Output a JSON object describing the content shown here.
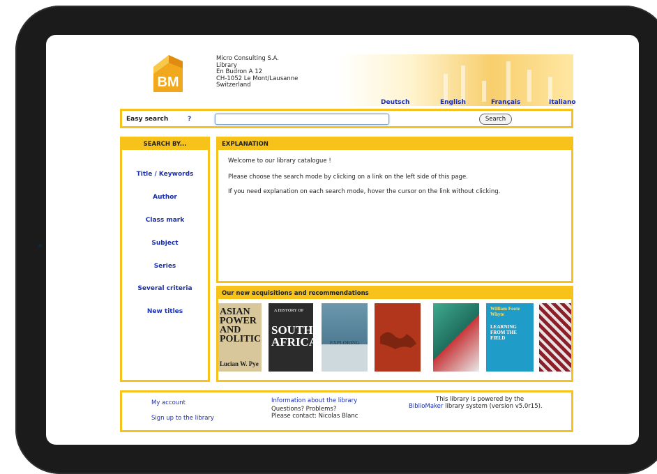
{
  "org": {
    "logo_text": "BM",
    "address_lines": [
      "Micro Consulting S.A.",
      "Library",
      "En Budron A 12",
      "CH-1052 Le Mont/Lausanne",
      "Switzerland"
    ]
  },
  "languages": [
    "Deutsch",
    "English",
    "Français",
    "Italiano"
  ],
  "search": {
    "label": "Easy search",
    "help": "?",
    "value": "",
    "button": "Search"
  },
  "search_by": {
    "title": "SEARCH BY...",
    "items": [
      "Title / Keywords",
      "Author",
      "Class mark",
      "Subject",
      "Series",
      "Several criteria",
      "New titles"
    ]
  },
  "explanation": {
    "title": "EXPLANATION",
    "lines": [
      "Welcome to our library catalogue !",
      "Please choose the search mode by clicking on a link on the left side of this page.",
      "If you need explanation on each search mode, hover the cursor on the link without clicking."
    ]
  },
  "acquisitions": {
    "title": "Our new acquisitions and recommendations",
    "books": [
      {
        "cover_text": "ASIAN POWER AND POLITICS",
        "author": "Lucian W. Pye",
        "color": "#d8c79a"
      },
      {
        "cover_text": "SOUTH AFRICA",
        "small": "A HISTORY OF",
        "color": "#2b2b2b"
      },
      {
        "cover_text": "EXPLORING",
        "color": "#5e8aa0"
      },
      {
        "cover_text": "",
        "color": "#b2361c"
      },
      {
        "cover_text": "",
        "color": "#2e9a82"
      },
      {
        "cover_text": "LEARNING FROM THE FIELD",
        "small": "William Foote Whyte",
        "color": "#1f9cc8"
      },
      {
        "cover_text": "",
        "color": "#8a1f2a"
      }
    ]
  },
  "footer": {
    "my_account": "My account",
    "sign_up": "Sign up to the library",
    "info": "Information about the library",
    "questions": "Questions? Problems?",
    "contact_prefix": "Please contact:",
    "contact_name": "Nicolas Blanc",
    "powered_1": "This library is powered by the",
    "powered_link": "BiblioMaker",
    "powered_2": "library system (version v5.0r15)."
  },
  "colors": {
    "accent": "#f7c31b",
    "link": "#1a2fb0",
    "frame": "#1b1b1b"
  }
}
